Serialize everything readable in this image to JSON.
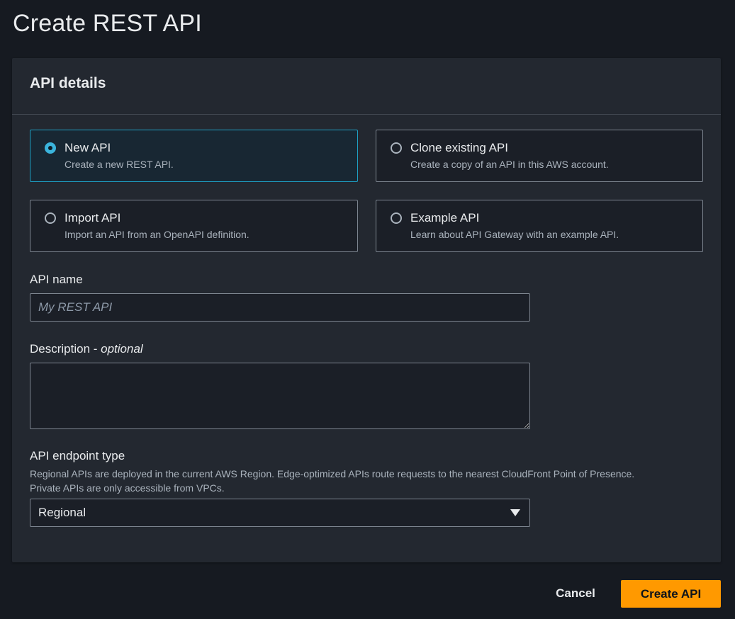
{
  "page": {
    "title": "Create REST API"
  },
  "panel": {
    "title": "API details",
    "options": [
      {
        "label": "New API",
        "description": "Create a new REST API.",
        "selected": true
      },
      {
        "label": "Clone existing API",
        "description": "Create a copy of an API in this AWS account.",
        "selected": false
      },
      {
        "label": "Import API",
        "description": "Import an API from an OpenAPI definition.",
        "selected": false
      },
      {
        "label": "Example API",
        "description": "Learn about API Gateway with an example API.",
        "selected": false
      }
    ],
    "api_name": {
      "label": "API name",
      "value": "",
      "placeholder": "My REST API"
    },
    "description": {
      "label": "Description - ",
      "optional": "optional",
      "value": ""
    },
    "endpoint_type": {
      "label": "API endpoint type",
      "help_line1": "Regional APIs are deployed in the current AWS Region. Edge-optimized APIs route requests to the nearest CloudFront Point of Presence.",
      "help_line2": "Private APIs are only accessible from VPCs.",
      "selected": "Regional"
    }
  },
  "footer": {
    "cancel_label": "Cancel",
    "create_label": "Create API"
  },
  "colors": {
    "accent": "#ff9900",
    "selected_border": "#1ea0c4",
    "background": "#161a21",
    "panel": "#232830"
  }
}
